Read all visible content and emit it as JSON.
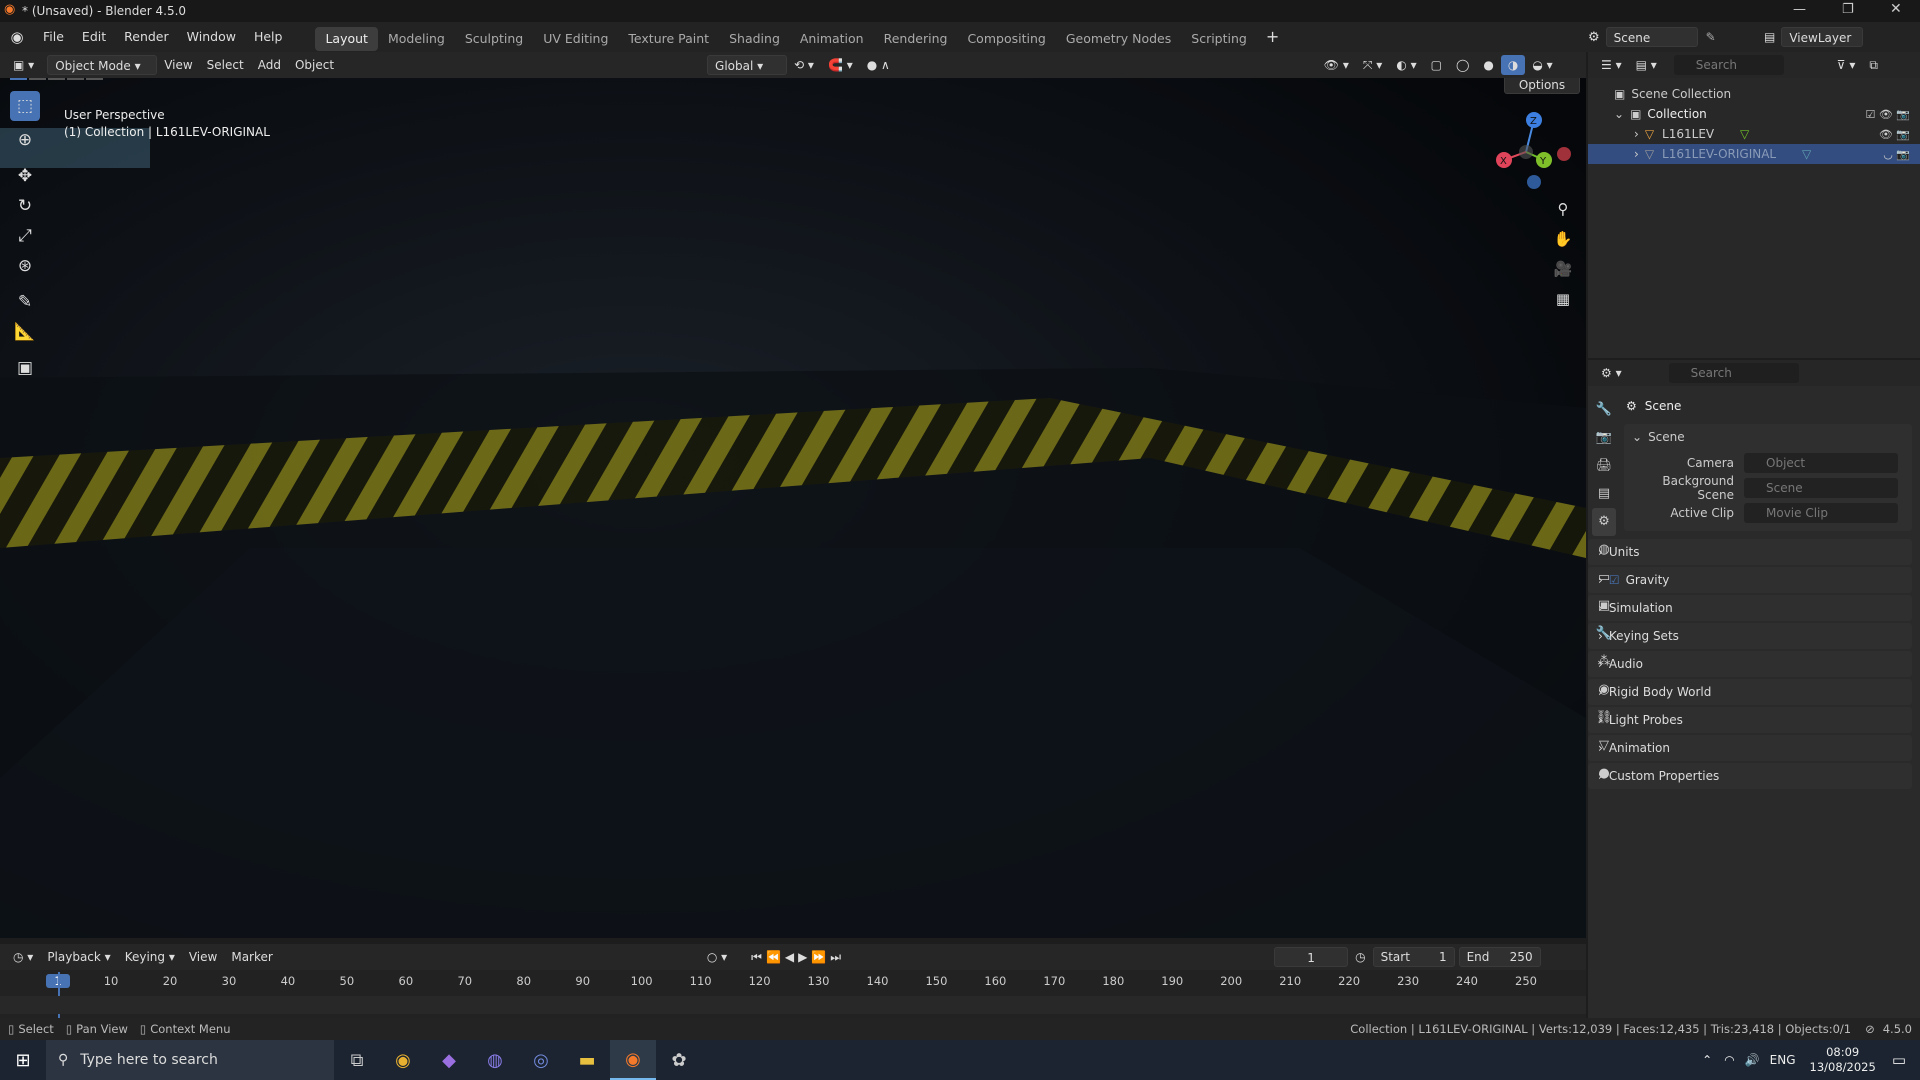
{
  "window": {
    "title": "* (Unsaved) - Blender 4.5.0"
  },
  "menu": [
    "File",
    "Edit",
    "Render",
    "Window",
    "Help"
  ],
  "workspaces": [
    "Layout",
    "Modeling",
    "Sculpting",
    "UV Editing",
    "Texture Paint",
    "Shading",
    "Animation",
    "Rendering",
    "Compositing",
    "Geometry Nodes",
    "Scripting"
  ],
  "active_workspace": "Layout",
  "topright": {
    "scene": "Scene",
    "viewlayer": "ViewLayer"
  },
  "viewport_header": {
    "mode": "Object Mode",
    "view": "View",
    "select": "Select",
    "add": "Add",
    "object": "Object",
    "orientation": "Global",
    "options": "Options"
  },
  "viewport_overlay": {
    "line1": "User Perspective",
    "line2": "(1) Collection | L161LEV-ORIGINAL"
  },
  "gizmo": {
    "z": "Z",
    "x": "X",
    "y": "Y"
  },
  "outliner": {
    "search_placeholder": "Search",
    "root": "Scene Collection",
    "collection": "Collection",
    "items": [
      "L161LEV",
      "L161LEV-ORIGINAL"
    ]
  },
  "properties": {
    "search_placeholder": "Search",
    "context": "Scene",
    "panel": "Scene",
    "fields": [
      {
        "label": "Camera",
        "value": "Object"
      },
      {
        "label": "Background Scene",
        "value": "Scene"
      },
      {
        "label": "Active Clip",
        "value": "Movie Clip"
      }
    ],
    "sections": [
      "Units",
      "Gravity",
      "Simulation",
      "Keying Sets",
      "Audio",
      "Rigid Body World",
      "Light Probes",
      "Animation",
      "Custom Properties"
    ]
  },
  "timeline_header": {
    "playback": "Playback",
    "keying": "Keying",
    "view": "View",
    "marker": "Marker",
    "current": "1",
    "start_label": "Start",
    "start": "1",
    "end_label": "End",
    "end": "250"
  },
  "timeline_ticks": [
    "1",
    "10",
    "20",
    "30",
    "40",
    "50",
    "60",
    "70",
    "80",
    "90",
    "100",
    "110",
    "120",
    "130",
    "140",
    "150",
    "160",
    "170",
    "180",
    "190",
    "200",
    "210",
    "220",
    "230",
    "240",
    "250"
  ],
  "statusbar": {
    "select": "Select",
    "pan": "Pan View",
    "context": "Context Menu",
    "stats": "Collection | L161LEV-ORIGINAL | Verts:12,039 | Faces:12,435 | Tris:23,418 | Objects:0/1",
    "version": "4.5.0"
  },
  "taskbar": {
    "search": "Type here to search",
    "lang": "ENG",
    "time": "08:09",
    "date": "13/08/2025"
  },
  "colors": {
    "accent": "#4772b3",
    "selected_row": "#334d80"
  }
}
